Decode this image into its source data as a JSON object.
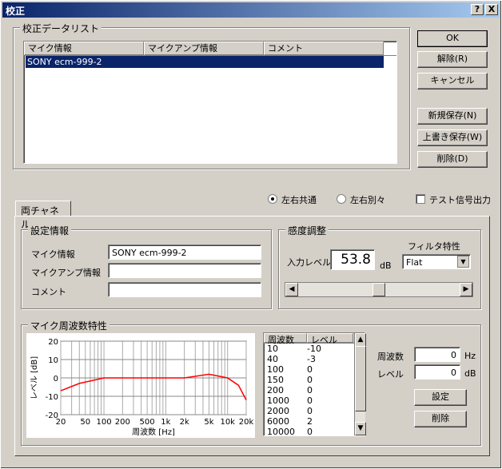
{
  "window": {
    "title": "校正",
    "help_label": "?",
    "close_label": "X"
  },
  "calibration_group": {
    "title": "校正データリスト"
  },
  "calibration_list": {
    "columns": [
      "マイク情報",
      "マイクアンプ情報",
      "コメント"
    ],
    "rows": [
      {
        "mic": "SONY ecm-999-2",
        "amp": "",
        "comment": ""
      }
    ]
  },
  "buttons": {
    "ok": "OK",
    "release": "解除(R)",
    "cancel": "キャンセル",
    "save_new": "新規保存(N)",
    "overwrite": "上書き保存(W)",
    "delete": "削除(D)",
    "setting": "設定",
    "delete_point": "削除"
  },
  "channel": {
    "tab": "両チャネル",
    "common_label": "左右共通",
    "separate_label": "左右別々",
    "selected": "common",
    "test_signal_label": "テスト信号出力",
    "test_signal_checked": false
  },
  "settings": {
    "title": "設定情報",
    "mic_label": "マイク情報",
    "mic_value": "SONY ecm-999-2",
    "amp_label": "マイクアンプ情報",
    "amp_value": "",
    "comment_label": "コメント",
    "comment_value": ""
  },
  "sensitivity": {
    "title": "感度調整",
    "input_level_label": "入力レベル",
    "input_level_value": "53.8",
    "unit": "dB",
    "filter_label": "フィルタ特性",
    "filter_value": "Flat",
    "slider_value": 0.5
  },
  "frequency": {
    "title": "マイク周波数特性",
    "table_headers": [
      "周波数",
      "レベル"
    ],
    "points": [
      [
        "10",
        "-10"
      ],
      [
        "40",
        "-3"
      ],
      [
        "100",
        "0"
      ],
      [
        "150",
        "0"
      ],
      [
        "200",
        "0"
      ],
      [
        "1000",
        "0"
      ],
      [
        "2000",
        "0"
      ],
      [
        "6000",
        "2"
      ],
      [
        "10000",
        "0"
      ]
    ],
    "freq_label": "周波数",
    "freq_value": "0",
    "freq_unit": "Hz",
    "level_label": "レベル",
    "level_value": "0",
    "level_unit": "dB"
  },
  "chart_data": {
    "type": "line",
    "xlabel": "周波数 [Hz]",
    "ylabel": "レベル [dB]",
    "ylim": [
      -20,
      20
    ],
    "x_ticks": [
      "20",
      "50",
      "100",
      "200",
      "500",
      "1k",
      "2k",
      "5k",
      "10k",
      "20k"
    ],
    "y_ticks": [
      "20",
      "10",
      "0",
      "-10",
      "-20"
    ],
    "x": [
      20,
      40,
      100,
      150,
      200,
      1000,
      2000,
      5000,
      10000,
      15000,
      20000
    ],
    "values": [
      -7,
      -3,
      0,
      0,
      0,
      0,
      0,
      2,
      0,
      -4,
      -12
    ],
    "line_color": "#ff0000"
  }
}
